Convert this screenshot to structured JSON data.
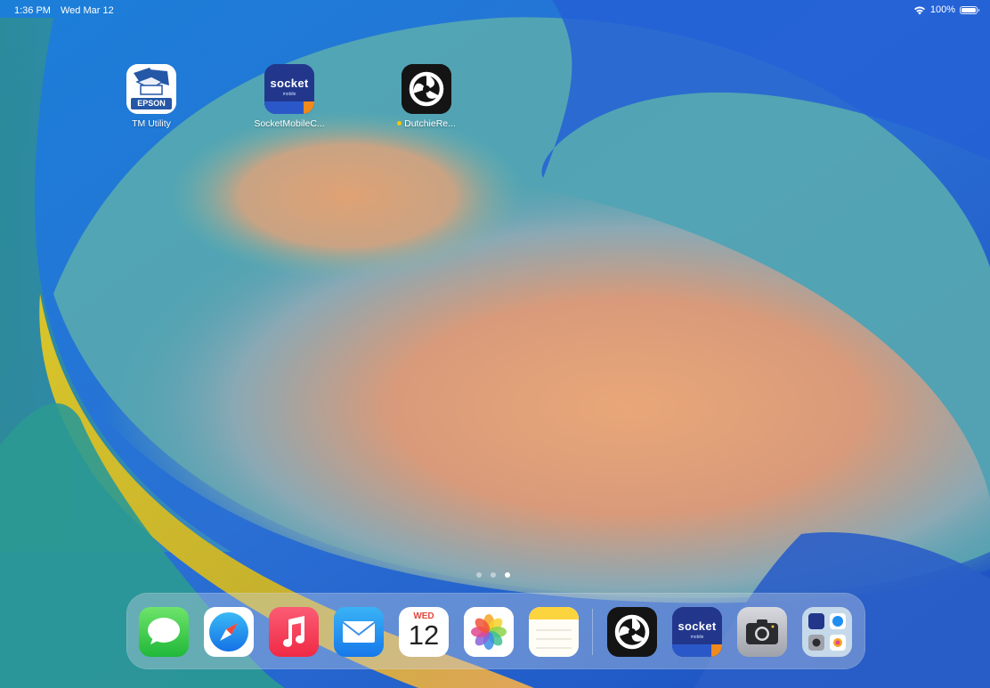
{
  "status_bar": {
    "time": "1:36 PM",
    "date": "Wed Mar 12",
    "battery_percent": "100%",
    "battery_level": 1.0,
    "icons": [
      "wifi-icon",
      "battery-icon"
    ]
  },
  "home_apps": [
    {
      "id": "tm-utility",
      "label": "TM Utility",
      "icon": "epson-printer-icon",
      "icon_text": "EPSON"
    },
    {
      "id": "socketmobile",
      "label": "SocketMobileC...",
      "icon": "socket-mobile-icon",
      "icon_text": "socket",
      "icon_subtext": "mobile"
    },
    {
      "id": "dutchie",
      "label": "DutchieRe...",
      "icon": "dutchie-swirl-icon",
      "new_badge": true
    }
  ],
  "pages": {
    "count": 3,
    "active": 3
  },
  "dock": {
    "apps": [
      {
        "id": "messages",
        "icon": "messages-icon"
      },
      {
        "id": "safari",
        "icon": "safari-compass-icon"
      },
      {
        "id": "music",
        "icon": "music-note-icon"
      },
      {
        "id": "mail",
        "icon": "mail-envelope-icon"
      },
      {
        "id": "calendar",
        "icon": "calendar-icon",
        "day": "WED",
        "date": "12"
      },
      {
        "id": "photos",
        "icon": "photos-flower-icon"
      },
      {
        "id": "notes",
        "icon": "notes-icon"
      }
    ],
    "recent_apps": [
      {
        "id": "dutchie",
        "icon": "dutchie-swirl-icon"
      },
      {
        "id": "socketmobile",
        "icon": "socket-mobile-icon",
        "icon_text": "socket",
        "icon_subtext": "mobile"
      },
      {
        "id": "camera",
        "icon": "camera-icon"
      },
      {
        "id": "app-library",
        "icon": "app-library-icon"
      }
    ]
  },
  "colors": {
    "wallpaper_blue": "#1f6fd6",
    "wallpaper_orange": "#e8a06a",
    "wallpaper_teal": "#4fa7a6",
    "wallpaper_yellow": "#d4c22c",
    "dock_glass": "#c8d2e1"
  }
}
